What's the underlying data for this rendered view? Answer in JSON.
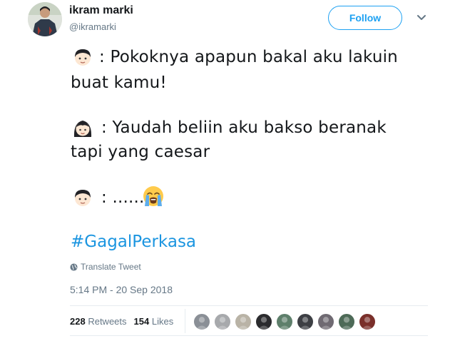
{
  "author": {
    "display_name": "ikram marki",
    "handle": "@ikramarki"
  },
  "follow_button": {
    "label": "Follow"
  },
  "tweet": {
    "line1": ":  Pokoknya apapun bakal aku lakuin",
    "line2": "buat kamu!",
    "line3": ": Yaudah beliin aku bakso beranak",
    "line4": "tapi yang caesar",
    "line5": ": ......",
    "hashtag": "#GagalPerkasa",
    "emojis": [
      "boy-emoji",
      "girl-emoji",
      "boy-emoji",
      "loudly-crying-face-emoji"
    ]
  },
  "translate_label": "Translate Tweet",
  "timestamp": "5:14 PM - 20 Sep 2018",
  "stats": {
    "retweets_count": "228",
    "retweets_label": "Retweets",
    "likes_count": "154",
    "likes_label": "Likes"
  },
  "likers": [
    {
      "name": "liker-avatar-1",
      "color": "#8a8f96"
    },
    {
      "name": "liker-avatar-2",
      "color": "#a7a9ac"
    },
    {
      "name": "liker-avatar-3",
      "color": "#b9b3a6"
    },
    {
      "name": "liker-avatar-4",
      "color": "#2b2b2e"
    },
    {
      "name": "liker-avatar-5",
      "color": "#5e7f6b"
    },
    {
      "name": "liker-avatar-6",
      "color": "#3d3f44"
    },
    {
      "name": "liker-avatar-7",
      "color": "#6f6a72"
    },
    {
      "name": "liker-avatar-8",
      "color": "#4d6a57"
    },
    {
      "name": "liker-avatar-9",
      "color": "#7a2f2a"
    }
  ],
  "colors": {
    "accent": "#1da1f2",
    "hashtag": "#1b95e0",
    "secondary_text": "#657786",
    "primary_text": "#14171a"
  }
}
